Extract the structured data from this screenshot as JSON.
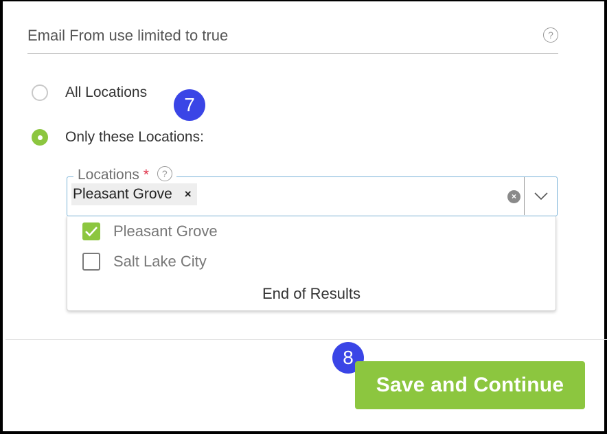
{
  "email_field": {
    "value": "Email From use limited to true",
    "help_icon": "?"
  },
  "location_scope": {
    "options": [
      {
        "label": "All Locations",
        "selected": false
      },
      {
        "label": "Only these Locations:",
        "selected": true
      }
    ]
  },
  "step_badges": [
    "7",
    "8"
  ],
  "locations_select": {
    "label": "Locations",
    "required_mark": "*",
    "help_icon": "?",
    "selected_chips": [
      {
        "label": "Pleasant Grove",
        "remove": "×"
      }
    ],
    "clear_icon": "×",
    "dropdown_options": [
      {
        "label": "Pleasant Grove",
        "checked": true
      },
      {
        "label": "Salt Lake City",
        "checked": false
      }
    ],
    "end_text": "End of Results"
  },
  "actions": {
    "save_label": "Save and Continue"
  },
  "colors": {
    "accent_green": "#8cc63f",
    "badge_blue": "#3a45e6",
    "focus_border": "#7ab3d8",
    "required_red": "#e0354c"
  }
}
